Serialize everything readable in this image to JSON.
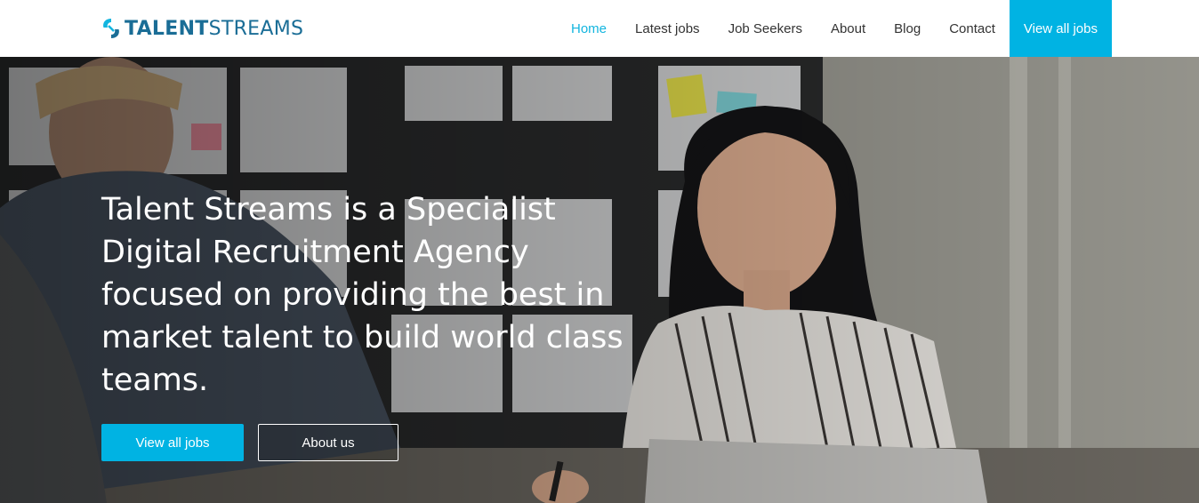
{
  "brand": {
    "name_bold": "TALENT",
    "name_light": "STREAMS",
    "logo_icon": "talentstreams-logo-icon",
    "color": "#1a6d96"
  },
  "nav": {
    "items": [
      {
        "label": "Home",
        "active": true
      },
      {
        "label": "Latest jobs",
        "active": false
      },
      {
        "label": "Job Seekers",
        "active": false
      },
      {
        "label": "About",
        "active": false
      },
      {
        "label": "Blog",
        "active": false
      },
      {
        "label": "Contact",
        "active": false
      }
    ],
    "cta_label": "View all jobs",
    "accent_color": "#00b3e3"
  },
  "hero": {
    "headline": "Talent Streams is a Specialist Digital Recruitment Agency focused on providing the best in market talent to build world class teams.",
    "primary_button": "View all jobs",
    "secondary_button": "About us"
  }
}
